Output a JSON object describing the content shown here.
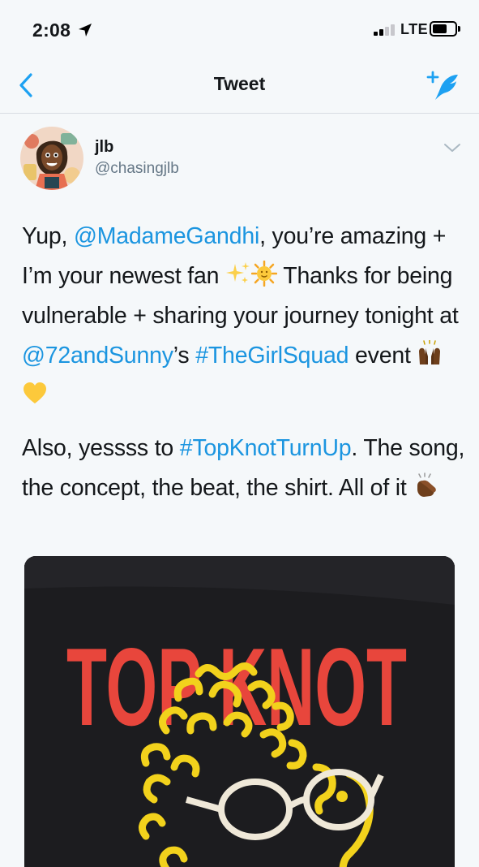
{
  "status": {
    "time": "2:08",
    "network": "LTE",
    "icons": [
      "location-arrow-icon",
      "signal-bars-icon",
      "battery-icon"
    ]
  },
  "nav": {
    "title": "Tweet",
    "back_icon": "chevron-left-icon",
    "compose_icon": "compose-tweet-icon"
  },
  "tweet": {
    "author": {
      "name": "jlb",
      "handle": "@chasingjlb",
      "avatar": "illustrated-avatar"
    },
    "menu_icon": "chevron-down-icon",
    "text": {
      "p1": [
        "Yup, ",
        "@MadameGandhi",
        ", you’re amazing + I’m your newest fan ",
        " Thanks for being vulnerable + sharing your journey tonight at ",
        "@72andSunny",
        "’s ",
        "#TheGirlSquad",
        " event "
      ],
      "p2": [
        "Also, yessss to ",
        "#TopKnotTurnUp",
        ". The song, the concept, the beat, the shirt. All of it "
      ]
    },
    "emojis": [
      "sparkles",
      "sun-with-face",
      "raising-hands",
      "yellow-heart",
      "clapping-hands"
    ],
    "media": {
      "shirt_text": "TOP KNOT",
      "colors": {
        "shirt": "#1c1c1f",
        "letters": "#e8463c",
        "curls": "#f2d21c"
      }
    }
  },
  "colors": {
    "link": "#1b95e0",
    "accent": "#1da1f2",
    "muted": "#657786",
    "background": "#f5f8fa"
  }
}
